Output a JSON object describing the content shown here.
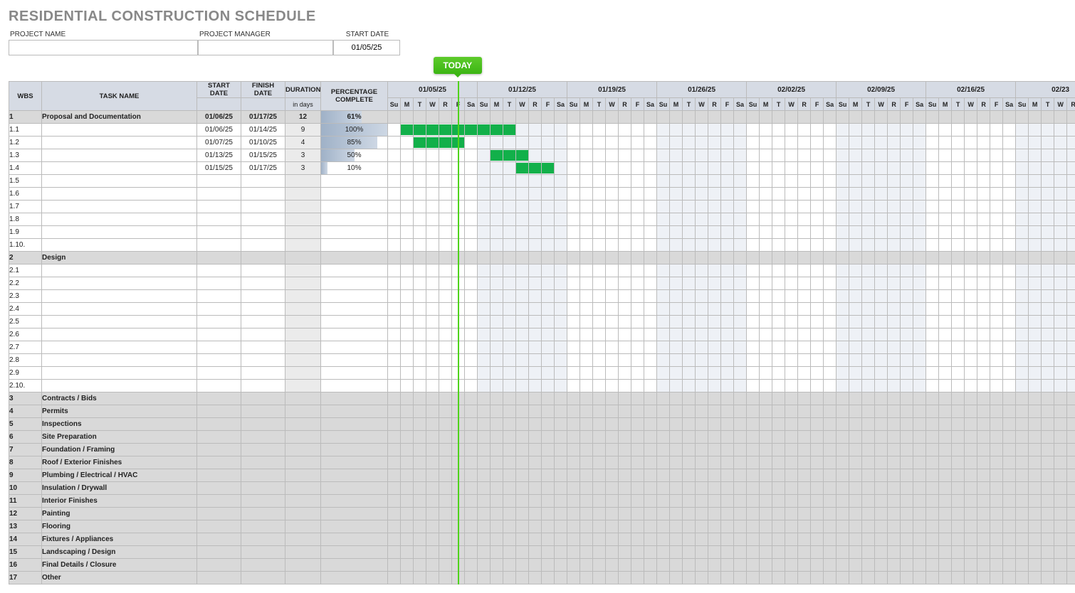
{
  "title": "RESIDENTIAL CONSTRUCTION SCHEDULE",
  "labels": {
    "project_name": "PROJECT NAME",
    "project_manager": "PROJECT MANAGER",
    "start_date": "START DATE",
    "today": "TODAY"
  },
  "inputs": {
    "project_name": "",
    "project_manager": "",
    "start_date": "01/05/25"
  },
  "columns": {
    "wbs": "WBS",
    "task": "TASK NAME",
    "start": "START DATE",
    "finish": "FINISH DATE",
    "duration": "DURATION",
    "duration_sub": "in days",
    "pct": "PERCENTAGE COMPLETE"
  },
  "weeks": [
    "01/05/25",
    "01/12/25",
    "01/19/25",
    "01/26/25",
    "02/02/25",
    "02/09/25",
    "02/16/25",
    "02/23"
  ],
  "day_labels": [
    "Su",
    "M",
    "T",
    "W",
    "R",
    "F",
    "Sa"
  ],
  "today_index": 5,
  "rows": [
    {
      "wbs": "1",
      "task": "Proposal and Documentation",
      "start": "01/06/25",
      "finish": "01/17/25",
      "dur": "12",
      "pct": "61%",
      "pct_w": 61,
      "phase": true,
      "bar_start": null,
      "bar_end": null
    },
    {
      "wbs": "1.1",
      "task": "",
      "start": "01/06/25",
      "finish": "01/14/25",
      "dur": "9",
      "pct": "100%",
      "pct_w": 100,
      "bar_start": 1,
      "bar_end": 9
    },
    {
      "wbs": "1.2",
      "task": "",
      "start": "01/07/25",
      "finish": "01/10/25",
      "dur": "4",
      "pct": "85%",
      "pct_w": 85,
      "bar_start": 2,
      "bar_end": 5
    },
    {
      "wbs": "1.3",
      "task": "",
      "start": "01/13/25",
      "finish": "01/15/25",
      "dur": "3",
      "pct": "50%",
      "pct_w": 50,
      "bar_start": 8,
      "bar_end": 10
    },
    {
      "wbs": "1.4",
      "task": "",
      "start": "01/15/25",
      "finish": "01/17/25",
      "dur": "3",
      "pct": "10%",
      "pct_w": 10,
      "bar_start": 10,
      "bar_end": 12
    },
    {
      "wbs": "1.5"
    },
    {
      "wbs": "1.6"
    },
    {
      "wbs": "1.7"
    },
    {
      "wbs": "1.8"
    },
    {
      "wbs": "1.9"
    },
    {
      "wbs": "1.10."
    },
    {
      "wbs": "2",
      "task": "Design",
      "phase": true
    },
    {
      "wbs": "2.1"
    },
    {
      "wbs": "2.2"
    },
    {
      "wbs": "2.3"
    },
    {
      "wbs": "2.4"
    },
    {
      "wbs": "2.5"
    },
    {
      "wbs": "2.6"
    },
    {
      "wbs": "2.7"
    },
    {
      "wbs": "2.8"
    },
    {
      "wbs": "2.9"
    },
    {
      "wbs": "2.10."
    },
    {
      "wbs": "3",
      "task": "Contracts / Bids",
      "phase": true
    },
    {
      "wbs": "4",
      "task": "Permits",
      "phase": true
    },
    {
      "wbs": "5",
      "task": "Inspections",
      "phase": true
    },
    {
      "wbs": "6",
      "task": "Site Preparation",
      "phase": true
    },
    {
      "wbs": "7",
      "task": "Foundation / Framing",
      "phase": true
    },
    {
      "wbs": "8",
      "task": "Roof / Exterior Finishes",
      "phase": true
    },
    {
      "wbs": "9",
      "task": "Plumbing / Electrical / HVAC",
      "phase": true
    },
    {
      "wbs": "10",
      "task": "Insulation / Drywall",
      "phase": true
    },
    {
      "wbs": "11",
      "task": "Interior Finishes",
      "phase": true
    },
    {
      "wbs": "12",
      "task": "Painting",
      "phase": true
    },
    {
      "wbs": "13",
      "task": "Flooring",
      "phase": true
    },
    {
      "wbs": "14",
      "task": "Fixtures / Appliances",
      "phase": true
    },
    {
      "wbs": "15",
      "task": "Landscaping / Design",
      "phase": true
    },
    {
      "wbs": "16",
      "task": "Final Details / Closure",
      "phase": true
    },
    {
      "wbs": "17",
      "task": "Other",
      "phase": true
    }
  ],
  "day_shade_weeks": [
    1,
    3,
    5,
    7
  ]
}
